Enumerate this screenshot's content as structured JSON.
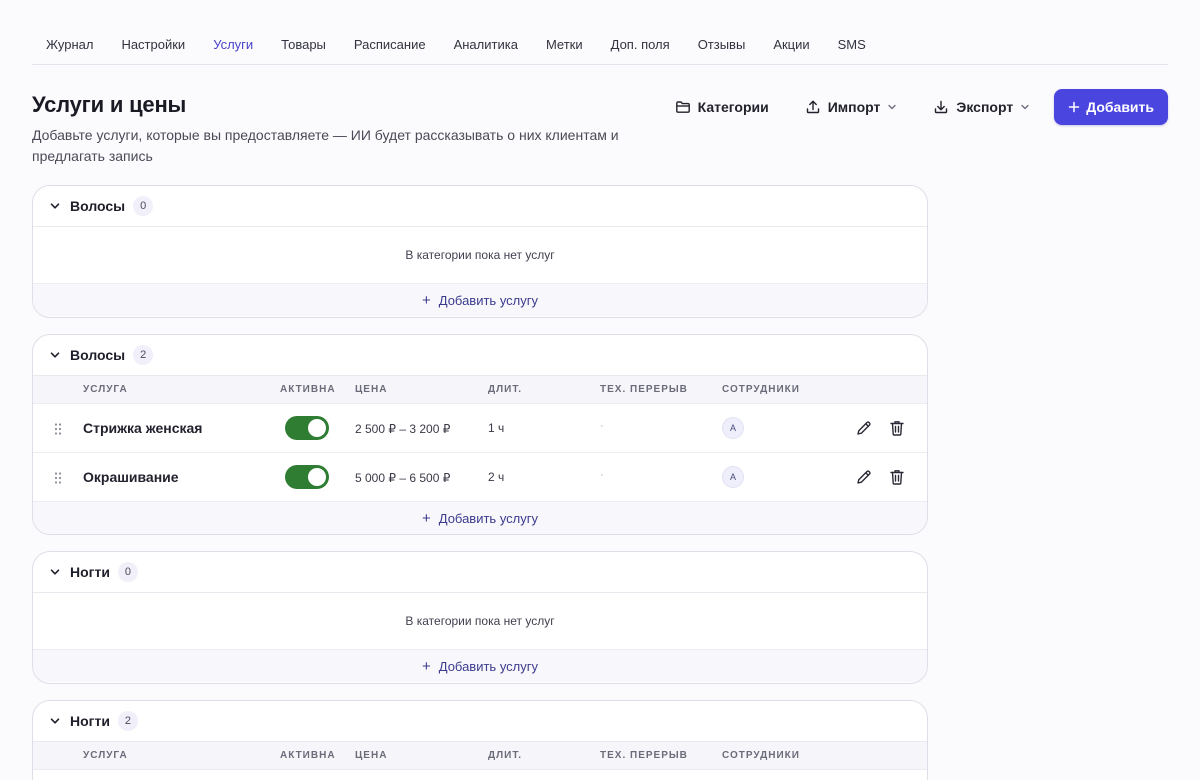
{
  "tabs": [
    "Журнал",
    "Настройки",
    "Услуги",
    "Товары",
    "Расписание",
    "Аналитика",
    "Метки",
    "Доп. поля",
    "Отзывы",
    "Акции",
    "SMS"
  ],
  "active_tab_index": 2,
  "page": {
    "title": "Услуги и цены",
    "description": "Добавьте услуги, которые вы предоставляете — ИИ будет рассказывать о них клиентам и предлагать запись"
  },
  "toolbar": {
    "categories_label": "Категории",
    "import_label": "Импорт",
    "export_label": "Экспорт",
    "add_label": "Добавить"
  },
  "table_headers": {
    "service": "УСЛУГА",
    "active": "АКТИВНА",
    "price": "ЦЕНА",
    "duration": "ДЛИТ.",
    "break": "ТЕХ. ПЕРЕРЫВ",
    "staff": "СОТРУДНИКИ"
  },
  "empty_text": "В категории пока нет услуг",
  "add_service_label": "Добавить услугу",
  "categories": [
    {
      "name": "Волосы",
      "count": "0"
    },
    {
      "name": "Волосы",
      "count": "2",
      "services": [
        {
          "name": "Стрижка женская",
          "active": true,
          "price": "2 500 ₽ – 3 200 ₽",
          "duration": "1 ч",
          "break": "·",
          "staff": "А"
        },
        {
          "name": "Окрашивание",
          "active": true,
          "price": "5 000 ₽ – 6 500 ₽",
          "duration": "2 ч",
          "break": "·",
          "staff": "А"
        }
      ]
    },
    {
      "name": "Ногти",
      "count": "0"
    },
    {
      "name": "Ногти",
      "count": "2"
    }
  ],
  "colors": {
    "accent": "#4b45e0",
    "active_tab": "#4a43c9",
    "toggle_on": "#2e7d32"
  },
  "icons": {
    "categories": "folder-icon",
    "import": "upload-icon",
    "export": "download-icon",
    "add": "plus-icon",
    "collapse": "chevron-down-icon",
    "drag": "drag-handle-icon",
    "edit": "pencil-icon",
    "delete": "trash-icon"
  }
}
